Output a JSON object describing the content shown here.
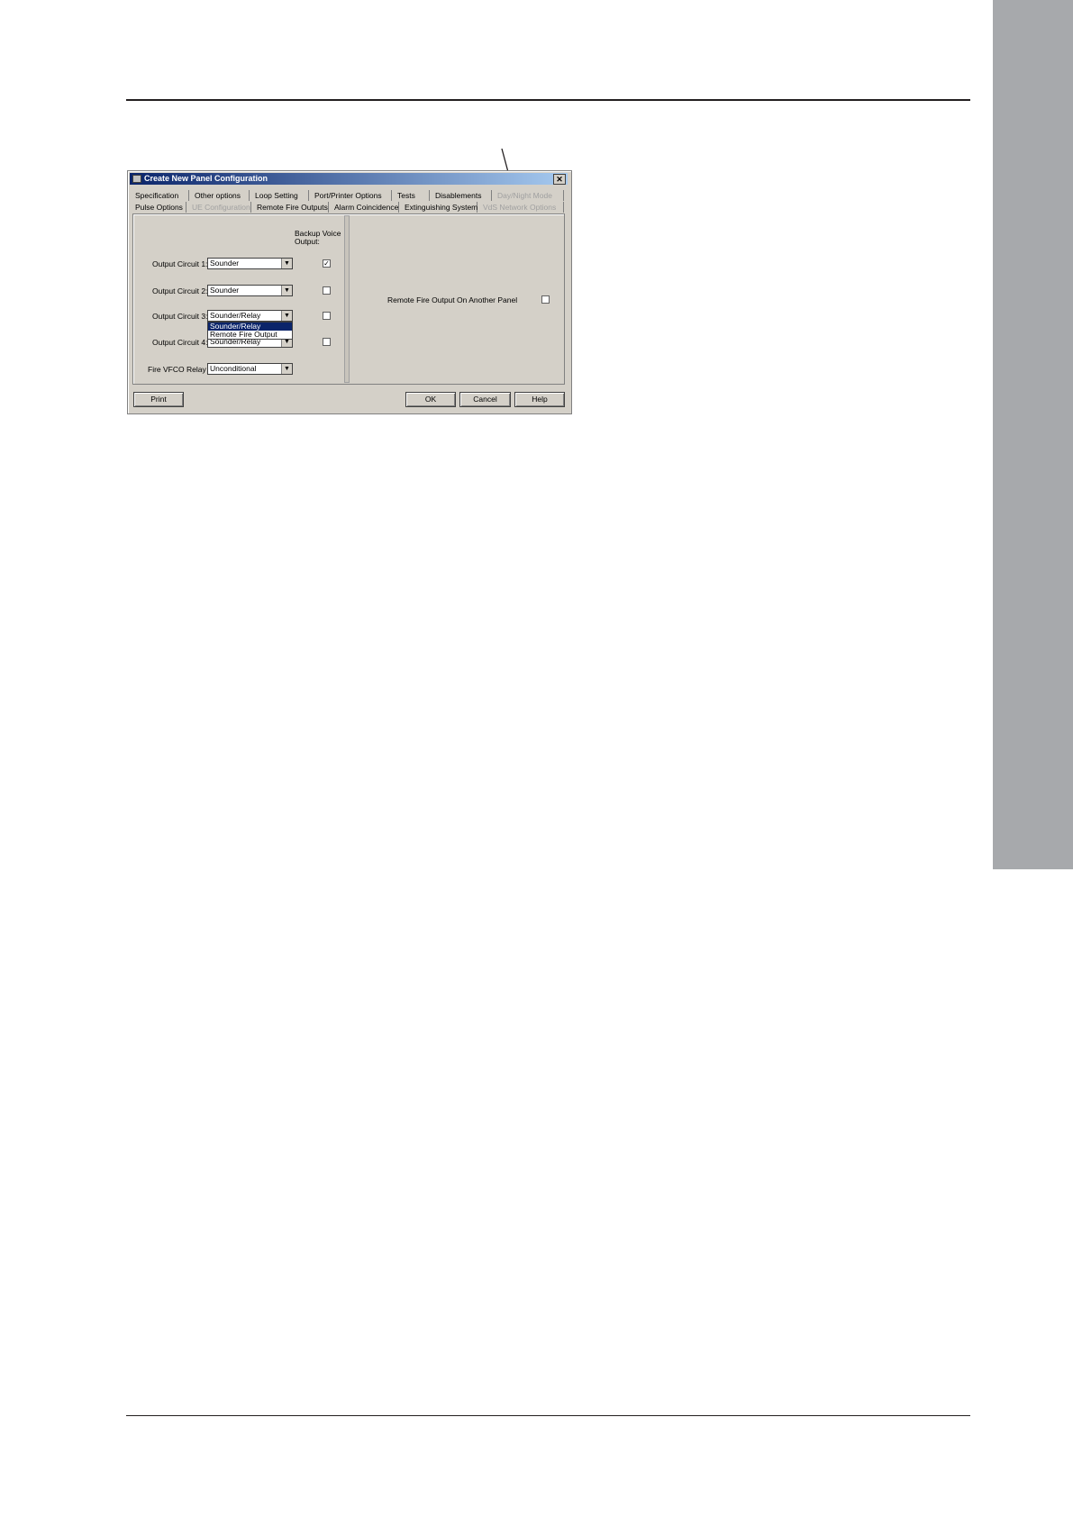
{
  "dialog": {
    "title": "Create New Panel Configuration",
    "close_glyph": "✕",
    "tabs_row1": [
      {
        "label": "Specification",
        "disabled": false
      },
      {
        "label": "Other options",
        "disabled": false
      },
      {
        "label": "Loop Setting",
        "disabled": false
      },
      {
        "label": "Port/Printer Options",
        "disabled": false
      },
      {
        "label": "Tests",
        "disabled": false
      },
      {
        "label": "Disablements",
        "disabled": false
      },
      {
        "label": "Day/Night Mode",
        "disabled": true
      }
    ],
    "tabs_row2": [
      {
        "label": "Pulse Options",
        "disabled": false
      },
      {
        "label": "UE Configuration",
        "disabled": true
      },
      {
        "label": "Remote Fire Outputs",
        "disabled": false,
        "active": true
      },
      {
        "label": "Alarm Coincidence",
        "disabled": false
      },
      {
        "label": "Extinguishing System",
        "disabled": false
      },
      {
        "label": "VdS Network Options",
        "disabled": true
      }
    ],
    "backup_voice_header": [
      "Backup Voice",
      "Output:"
    ],
    "outputs": [
      {
        "label": "Output Circuit 1:",
        "value": "Sounder",
        "backup_checked": true
      },
      {
        "label": "Output Circuit 2:",
        "value": "Sounder",
        "backup_checked": false
      },
      {
        "label": "Output Circuit 3:",
        "value": "Sounder/Relay",
        "backup_checked": false
      },
      {
        "label": "Output Circuit 4:",
        "value": "Sounder/Relay",
        "backup_checked": false
      }
    ],
    "dropdown_options": [
      "Sounder/Relay",
      "Remote Fire Output"
    ],
    "dropdown_selected": "Sounder/Relay",
    "fire_vfco": {
      "label": "Fire VFCO Relay",
      "value": "Unconditional"
    },
    "remote_fire_output": {
      "label": "Remote Fire Output On Another Panel",
      "checked": false
    },
    "buttons": {
      "print": "Print",
      "ok": "OK",
      "cancel": "Cancel",
      "help": "Help"
    }
  }
}
